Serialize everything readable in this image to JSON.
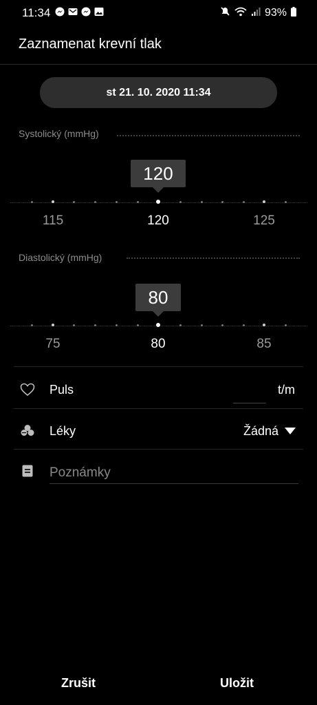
{
  "status": {
    "time": "11:34",
    "battery": "93%"
  },
  "header": {
    "title": "Zaznamenat krevní tlak"
  },
  "date": {
    "value": "st 21. 10. 2020 11:34"
  },
  "systolic": {
    "label": "Systolický (mmHg)",
    "value": "120",
    "ticks": [
      "115",
      "120",
      "125"
    ]
  },
  "diastolic": {
    "label": "Diastolický (mmHg)",
    "value": "80",
    "ticks": [
      "75",
      "80",
      "85"
    ]
  },
  "pulse": {
    "label": "Puls",
    "unit": "t/m"
  },
  "meds": {
    "label": "Léky",
    "value": "Žádná"
  },
  "notes": {
    "placeholder": "Poznámky"
  },
  "actions": {
    "cancel": "Zrušit",
    "save": "Uložit"
  }
}
